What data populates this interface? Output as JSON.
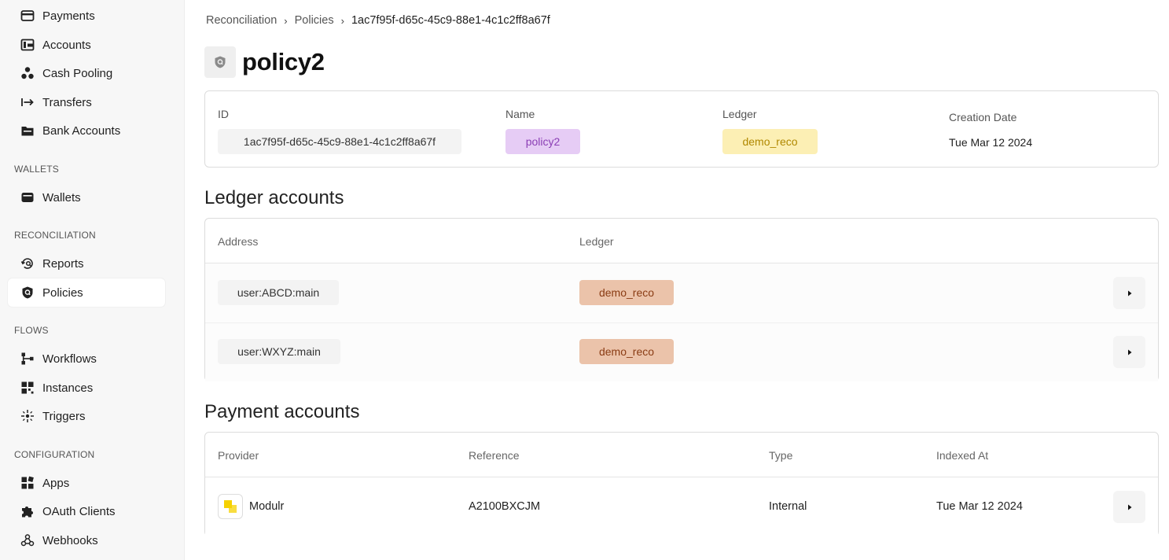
{
  "sidebar": {
    "items": [
      {
        "label": "Payments",
        "icon": "credit-card-icon"
      },
      {
        "label": "Accounts",
        "icon": "wallet-card-icon"
      },
      {
        "label": "Cash Pooling",
        "icon": "circles-icon"
      },
      {
        "label": "Transfers",
        "icon": "arrow-right-bar-icon"
      },
      {
        "label": "Bank Accounts",
        "icon": "folder-icon"
      }
    ],
    "wallets_section": "WALLETS",
    "wallets_items": [
      {
        "label": "Wallets",
        "icon": "wallet-icon"
      }
    ],
    "reconciliation_section": "RECONCILIATION",
    "reconciliation_items": [
      {
        "label": "Reports",
        "icon": "history-search-icon"
      },
      {
        "label": "Policies",
        "icon": "shield-icon"
      }
    ],
    "flows_section": "FLOWS",
    "flows_items": [
      {
        "label": "Workflows",
        "icon": "workflow-icon"
      },
      {
        "label": "Instances",
        "icon": "grid-icon"
      },
      {
        "label": "Triggers",
        "icon": "spark-icon"
      }
    ],
    "configuration_section": "CONFIGURATION",
    "configuration_items": [
      {
        "label": "Apps",
        "icon": "apps-icon"
      },
      {
        "label": "OAuth Clients",
        "icon": "puzzle-icon"
      },
      {
        "label": "Webhooks",
        "icon": "webhook-icon"
      }
    ]
  },
  "breadcrumb": {
    "items": [
      "Reconciliation",
      "Policies",
      "1ac7f95f-d65c-45c9-88e1-4c1c2ff8a67f"
    ]
  },
  "page": {
    "title": "policy2",
    "icon": "shield-icon"
  },
  "details": {
    "id_label": "ID",
    "id_value": "1ac7f95f-d65c-45c9-88e1-4c1c2ff8a67f",
    "name_label": "Name",
    "name_value": "policy2",
    "ledger_label": "Ledger",
    "ledger_value": "demo_reco",
    "creation_label": "Creation Date",
    "creation_value": "Tue Mar 12 2024"
  },
  "ledger_accounts": {
    "title": "Ledger accounts",
    "columns": [
      "Address",
      "Ledger"
    ],
    "rows": [
      {
        "address": "user:ABCD:main",
        "ledger": "demo_reco"
      },
      {
        "address": "user:WXYZ:main",
        "ledger": "demo_reco"
      }
    ]
  },
  "payment_accounts": {
    "title": "Payment accounts",
    "columns": [
      "Provider",
      "Reference",
      "Type",
      "Indexed At"
    ],
    "rows": [
      {
        "provider": "Modulr",
        "reference": "A2100BXCJM",
        "type": "Internal",
        "indexed_at": "Tue Mar 12 2024"
      }
    ]
  },
  "colors": {
    "name_chip_bg": "#e6ccf5",
    "ledger_chip_bg": "#fcefb4",
    "account_ledger_chip_bg": "#ebc3aa",
    "modulr_logo": "#f5d100"
  }
}
